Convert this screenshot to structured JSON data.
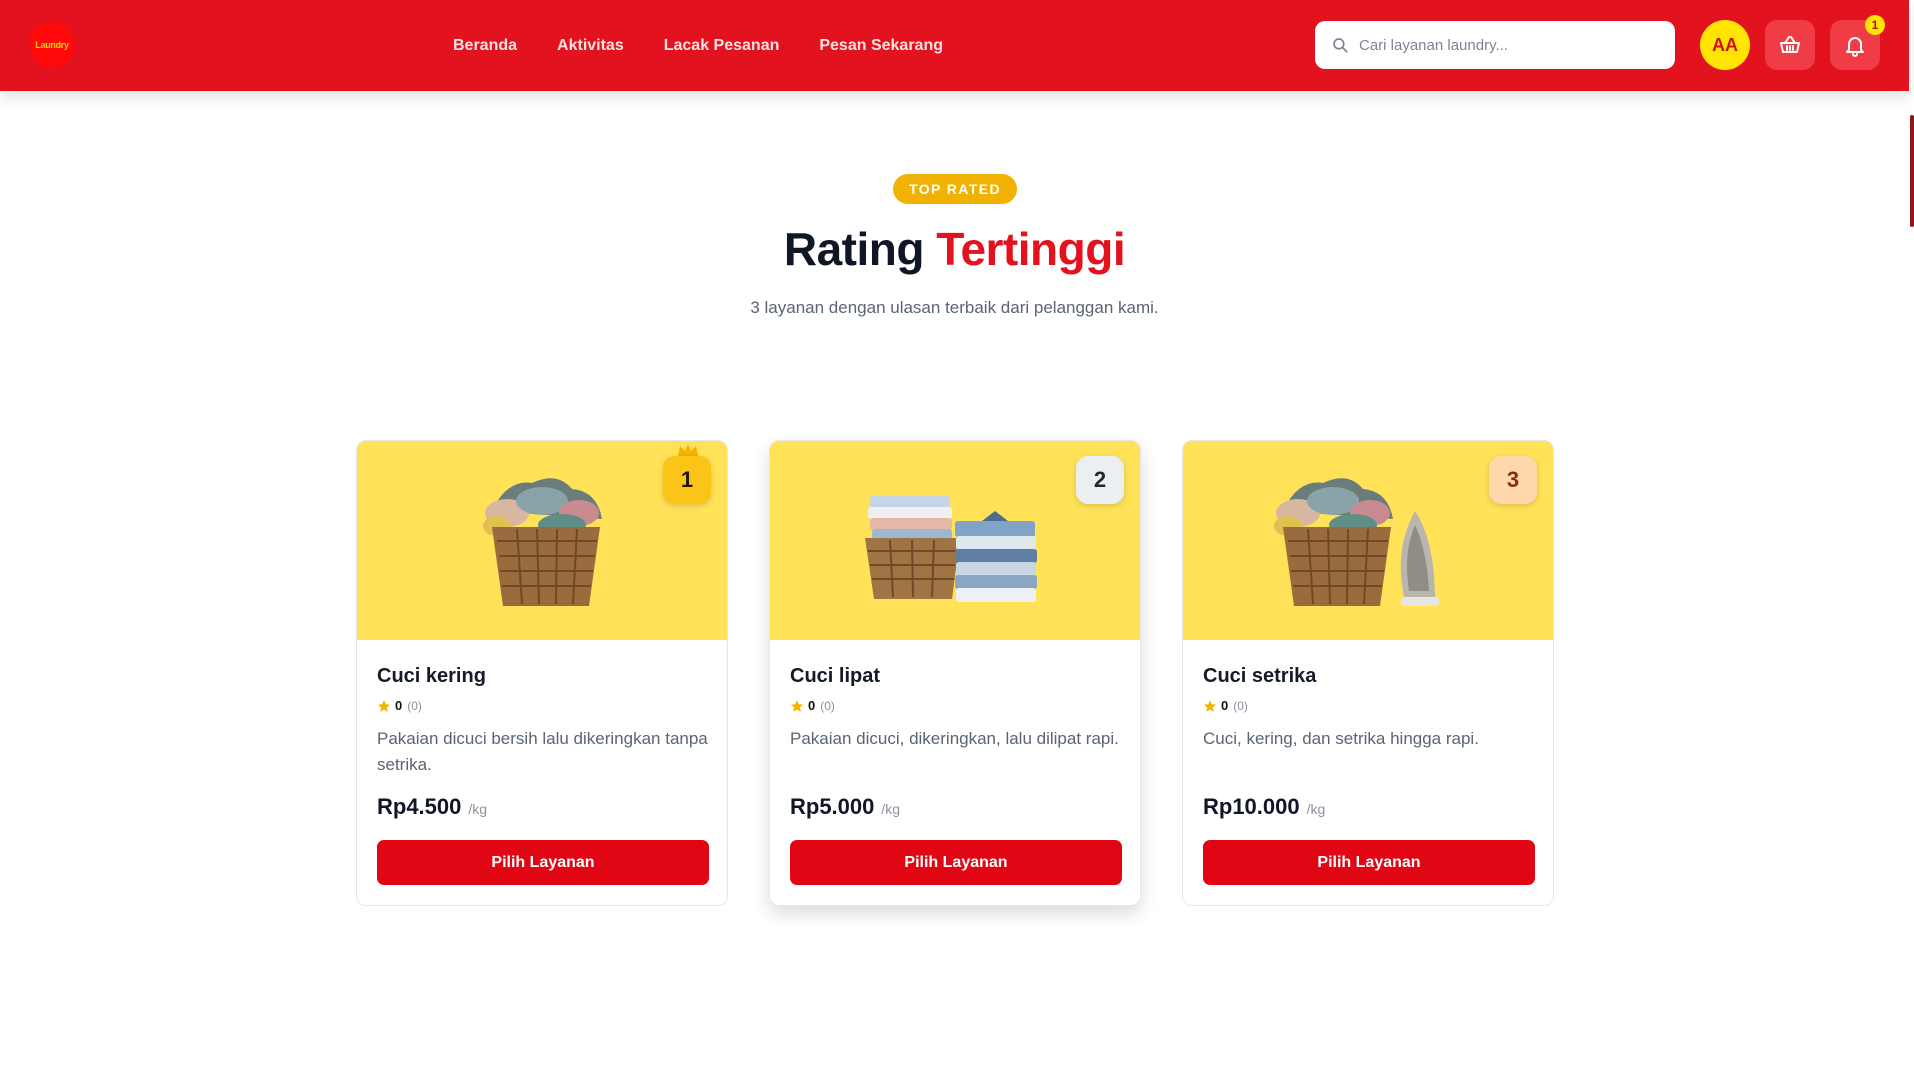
{
  "header": {
    "logo_text": "Laundry",
    "nav": [
      "Beranda",
      "Aktivitas",
      "Lacak Pesanan",
      "Pesan Sekarang"
    ],
    "search_placeholder": "Cari layanan laundry...",
    "avatar_initials": "AA",
    "notification_count": "1"
  },
  "section": {
    "badge": "TOP RATED",
    "title_main": "Rating",
    "title_accent": "Tertinggi",
    "subtitle": "3 layanan dengan ulasan terbaik dari pelanggan kami."
  },
  "cards": [
    {
      "rank": "1",
      "title": "Cuci kering",
      "score": "0",
      "reviews": "(0)",
      "desc": "Pakaian dicuci bersih lalu dikeringkan tanpa setrika.",
      "price": "Rp4.500",
      "unit": "/kg",
      "button": "Pilih Layanan"
    },
    {
      "rank": "2",
      "title": "Cuci lipat",
      "score": "0",
      "reviews": "(0)",
      "desc": "Pakaian dicuci, dikeringkan, lalu dilipat rapi.",
      "price": "Rp5.000",
      "unit": "/kg",
      "button": "Pilih Layanan"
    },
    {
      "rank": "3",
      "title": "Cuci setrika",
      "score": "0",
      "reviews": "(0)",
      "desc": "Cuci, kering, dan setrika hingga rapi.",
      "price": "Rp10.000",
      "unit": "/kg",
      "button": "Pilih Layanan"
    }
  ],
  "colors": {
    "brand_red": "#e3121f",
    "accent_yellow": "#ffe500",
    "card_image_bg": "#ffe257",
    "badge_amber": "#f2b203"
  }
}
